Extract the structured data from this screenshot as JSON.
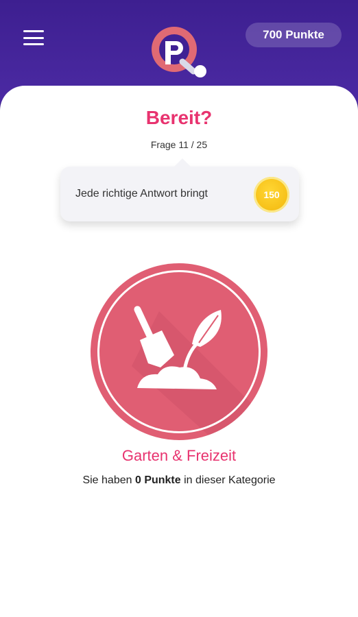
{
  "header": {
    "points_label": "700 Punkte",
    "menu_icon": "hamburger-menu-icon",
    "logo_icon": "quiz-q-logo"
  },
  "quiz": {
    "title": "Bereit?",
    "counter": "Frage 11 / 25",
    "reward_text": "Jede richtige Antwort bringt",
    "reward_value": "150"
  },
  "category": {
    "icon": "garden-shovel-plant-icon",
    "name": "Garten & Freizeit",
    "points_prefix": "Sie haben",
    "points_value": "0 Punkte",
    "points_suffix": "in dieser Kategorie"
  },
  "colors": {
    "header_bg": "#3d1f90",
    "accent_pink": "#e8336f",
    "category_red": "#e05e73",
    "coin_gold": "#f7c21a"
  }
}
